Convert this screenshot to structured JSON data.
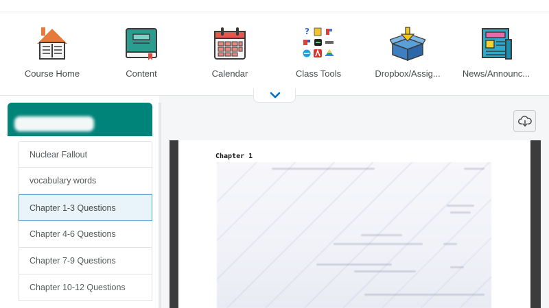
{
  "navbar": {
    "items": [
      {
        "label": "Course Home",
        "icon": "course-home-icon"
      },
      {
        "label": "Content",
        "icon": "content-book-icon"
      },
      {
        "label": "Calendar",
        "icon": "calendar-icon"
      },
      {
        "label": "Class Tools",
        "icon": "class-tools-grid-icon"
      },
      {
        "label": "Dropbox/Assig...",
        "icon": "dropbox-icon"
      },
      {
        "label": "News/Announc...",
        "icon": "news-icon"
      }
    ]
  },
  "course": {
    "name": ""
  },
  "toc": {
    "items": [
      {
        "label": "Nuclear Fallout"
      },
      {
        "label": "vocabulary words"
      },
      {
        "label": "Chapter 1-3 Questions"
      },
      {
        "label": "Chapter 4-6 Questions"
      },
      {
        "label": "Chapter 7-9 Questions"
      },
      {
        "label": "Chapter 10-12 Questions"
      }
    ],
    "selected_index": 2
  },
  "viewer": {
    "page_heading": "Chapter 1"
  },
  "colors": {
    "brand": "#00847a",
    "selected_border": "#4a9cd2",
    "selected_bg": "#e8f3fa",
    "accent_chevron": "#006fbf"
  }
}
